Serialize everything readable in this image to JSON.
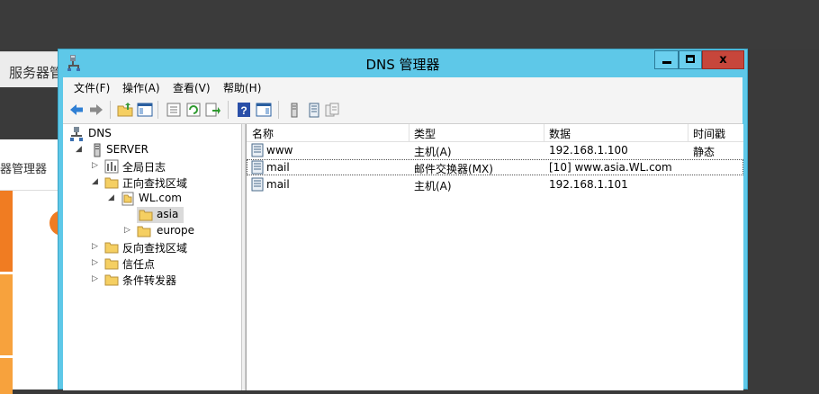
{
  "background": {
    "server_manager_title": "服务器管",
    "server_manager_panel_title": "器管理器"
  },
  "window": {
    "title": "DNS 管理器",
    "buttons": {
      "minimize": "minimize",
      "maximize": "maximize",
      "close": "x"
    }
  },
  "menu": [
    {
      "label": "文件(F)"
    },
    {
      "label": "操作(A)"
    },
    {
      "label": "查看(V)"
    },
    {
      "label": "帮助(H)"
    }
  ],
  "toolbar": [
    "back-arrow-icon",
    "forward-arrow-icon",
    "up-folder-icon",
    "show-hide-tree-icon",
    "properties-icon",
    "refresh-icon",
    "export-list-icon",
    "help-icon",
    "show-hide-action-pane-icon",
    "new-host-icon",
    "new-alias-icon",
    "new-mail-exchanger-icon"
  ],
  "tree": {
    "root": "DNS",
    "server": "SERVER",
    "global_logs": "全局日志",
    "forward_zones": "正向查找区域",
    "zone": "WL.com",
    "selected_domain": "asia",
    "other_domain": "europe",
    "reverse_zones": "反向查找区域",
    "trust_points": "信任点",
    "conditional_forwarders": "条件转发器"
  },
  "list": {
    "columns": [
      "名称",
      "类型",
      "数据",
      "时间戳"
    ],
    "rows": [
      {
        "name": "www",
        "type": "主机(A)",
        "data": "192.168.1.100",
        "timestamp": "静态"
      },
      {
        "name": "mail",
        "type": "邮件交换器(MX)",
        "data": "[10]  www.asia.WL.com",
        "timestamp": ""
      },
      {
        "name": "mail",
        "type": "主机(A)",
        "data": "192.168.1.101",
        "timestamp": ""
      }
    ]
  },
  "colors": {
    "titlebar": "#5ec8e8",
    "close_button": "#c7463b",
    "folder": "#f5cf62",
    "accent_orange": "#f07c22"
  }
}
